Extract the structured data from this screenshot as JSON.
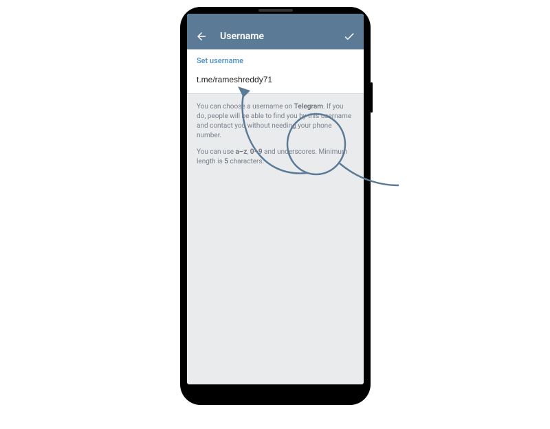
{
  "header": {
    "title": "Username"
  },
  "section": {
    "label": "Set username",
    "input_value": "t.me/rameshreddy71"
  },
  "info": {
    "paragraph1_pre": "You can choose a username on ",
    "paragraph1_b1": "Telegram",
    "paragraph1_post": ". If you do, people will be able to find you by this username and contact you without needing your phone number.",
    "paragraph2_pre": "You can use ",
    "paragraph2_b1": "a–z",
    "paragraph2_mid1": ", ",
    "paragraph2_b2": "0–9",
    "paragraph2_mid2": " and underscores. Minimum length is ",
    "paragraph2_b3": "5",
    "paragraph2_post": " characters."
  }
}
